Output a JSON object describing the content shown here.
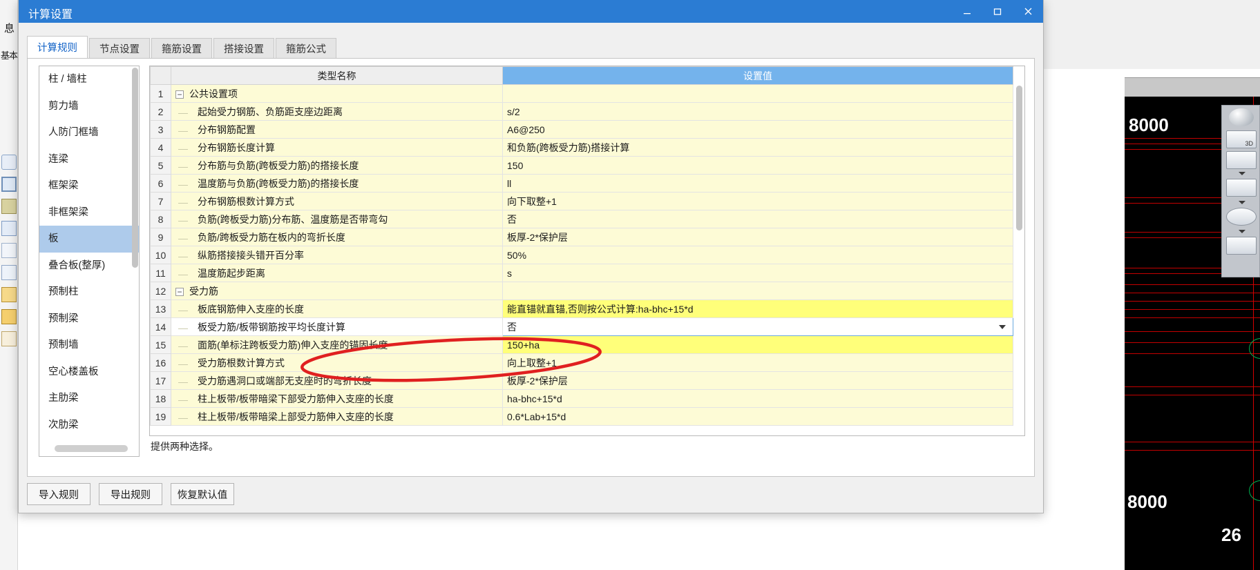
{
  "window": {
    "title": "计算设置",
    "controls": {
      "minimize": "—",
      "maximize": "▢",
      "close": "✕"
    }
  },
  "tabs": [
    {
      "label": "计算规则",
      "active": true
    },
    {
      "label": "节点设置",
      "active": false
    },
    {
      "label": "箍筋设置",
      "active": false
    },
    {
      "label": "搭接设置",
      "active": false
    },
    {
      "label": "箍筋公式",
      "active": false
    }
  ],
  "sidebar": {
    "items": [
      {
        "label": "柱 / 墙柱",
        "selected": false
      },
      {
        "label": "剪力墙",
        "selected": false
      },
      {
        "label": "人防门框墙",
        "selected": false
      },
      {
        "label": "连梁",
        "selected": false
      },
      {
        "label": "框架梁",
        "selected": false
      },
      {
        "label": "非框架梁",
        "selected": false
      },
      {
        "label": "板",
        "selected": true
      },
      {
        "label": "叠合板(整厚)",
        "selected": false
      },
      {
        "label": "预制柱",
        "selected": false
      },
      {
        "label": "预制梁",
        "selected": false
      },
      {
        "label": "预制墙",
        "selected": false
      },
      {
        "label": "空心楼盖板",
        "selected": false
      },
      {
        "label": "主肋梁",
        "selected": false
      },
      {
        "label": "次肋梁",
        "selected": false
      }
    ]
  },
  "grid": {
    "headers": {
      "index": "",
      "name": "类型名称",
      "value": "设置值"
    },
    "rows": [
      {
        "index": "1",
        "name": "公共设置项",
        "value": "",
        "kind": "group",
        "highlight": "yellow"
      },
      {
        "index": "2",
        "name": "起始受力钢筋、负筋距支座边距离",
        "value": "s/2",
        "kind": "item",
        "highlight": "yellow"
      },
      {
        "index": "3",
        "name": "分布钢筋配置",
        "value": "A6@250",
        "kind": "item",
        "highlight": "yellow"
      },
      {
        "index": "4",
        "name": "分布钢筋长度计算",
        "value": "和负筋(跨板受力筋)搭接计算",
        "kind": "item",
        "highlight": "yellow"
      },
      {
        "index": "5",
        "name": "分布筋与负筋(跨板受力筋)的搭接长度",
        "value": "150",
        "kind": "item",
        "highlight": "yellow"
      },
      {
        "index": "6",
        "name": "温度筋与负筋(跨板受力筋)的搭接长度",
        "value": "ll",
        "kind": "item",
        "highlight": "yellow"
      },
      {
        "index": "7",
        "name": "分布钢筋根数计算方式",
        "value": "向下取整+1",
        "kind": "item",
        "highlight": "yellow"
      },
      {
        "index": "8",
        "name": "负筋(跨板受力筋)分布筋、温度筋是否带弯勾",
        "value": "否",
        "kind": "item",
        "highlight": "yellow"
      },
      {
        "index": "9",
        "name": "负筋/跨板受力筋在板内的弯折长度",
        "value": "板厚-2*保护层",
        "kind": "item",
        "highlight": "yellow"
      },
      {
        "index": "10",
        "name": "纵筋搭接接头错开百分率",
        "value": "50%",
        "kind": "item",
        "highlight": "yellow"
      },
      {
        "index": "11",
        "name": "温度筋起步距离",
        "value": "s",
        "kind": "item",
        "highlight": "yellow"
      },
      {
        "index": "12",
        "name": "受力筋",
        "value": "",
        "kind": "group",
        "highlight": "yellow"
      },
      {
        "index": "13",
        "name": "板底钢筋伸入支座的长度",
        "value": "能直锚就直锚,否则按公式计算:ha-bhc+15*d",
        "kind": "item",
        "highlight": "yellow",
        "value_highlight": true
      },
      {
        "index": "14",
        "name": "板受力筋/板带钢筋按平均长度计算",
        "value": "否",
        "kind": "item",
        "highlight": "white",
        "selected": true,
        "editing": true
      },
      {
        "index": "15",
        "name": "面筋(单标注跨板受力筋)伸入支座的锚固长度",
        "value": "150+ha",
        "kind": "item",
        "highlight": "yellow",
        "value_highlight": true
      },
      {
        "index": "16",
        "name": "受力筋根数计算方式",
        "value": "向上取整+1",
        "kind": "item",
        "highlight": "yellow"
      },
      {
        "index": "17",
        "name": "受力筋遇洞口或端部无支座时的弯折长度",
        "value": "板厚-2*保护层",
        "kind": "item",
        "highlight": "yellow"
      },
      {
        "index": "18",
        "name": "柱上板带/板带暗梁下部受力筋伸入支座的长度",
        "value": "ha-bhc+15*d",
        "kind": "item",
        "highlight": "yellow"
      },
      {
        "index": "19",
        "name": "柱上板带/板带暗梁上部受力筋伸入支座的长度",
        "value": "0.6*Lab+15*d",
        "kind": "item",
        "highlight": "yellow"
      }
    ]
  },
  "status": {
    "text": "提供两种选择。"
  },
  "footer": {
    "buttons": [
      {
        "label": "导入规则"
      },
      {
        "label": "导出规则"
      },
      {
        "label": "恢复默认值"
      }
    ]
  },
  "background": {
    "left_labels": [
      "息",
      "基本"
    ],
    "cad_dimensions": [
      "8000",
      "8000",
      "26"
    ],
    "viewcube_label": "3D"
  },
  "colors": {
    "titlebar": "#2b7cd3",
    "value_header": "#74b3ec",
    "row_yellow": "#fdfbd6",
    "value_highlight": "#ffff7a",
    "selection": "#aecbeb",
    "annotation": "#e02020"
  }
}
